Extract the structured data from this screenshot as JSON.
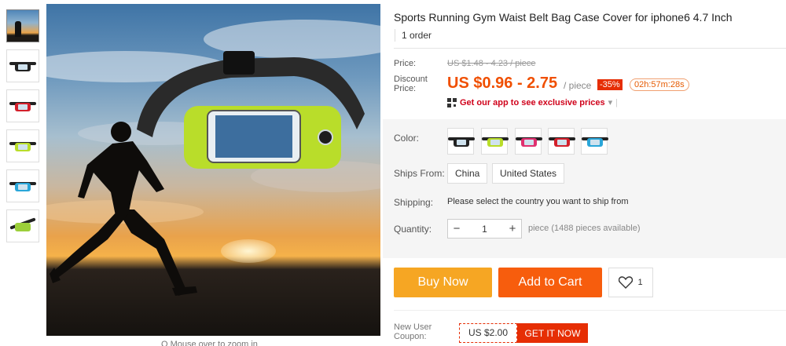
{
  "product": {
    "title": "Sports Running Gym Waist Belt Bag Case Cover for iphone6 4.7 Inch",
    "orders": "1 order"
  },
  "price": {
    "label": "Price:",
    "original": "US $1.48 - 4.23 / piece",
    "discount_label": "Discount Price:",
    "current": "US $0.96 - 2.75",
    "unit": "/ piece",
    "percent_off": "-35%",
    "countdown": "02h:57m:28s",
    "app_promo": "Get our app to see exclusive prices"
  },
  "colors": {
    "label": "Color:",
    "swatches": [
      {
        "name": "black",
        "pouch": "#222222"
      },
      {
        "name": "green",
        "pouch": "#b9dd2a"
      },
      {
        "name": "pink",
        "pouch": "#e0306f"
      },
      {
        "name": "red",
        "pouch": "#d3202b"
      },
      {
        "name": "blue",
        "pouch": "#2aa6d9"
      }
    ]
  },
  "shipping": {
    "from_label": "Ships From:",
    "from_options": [
      "China",
      "United States"
    ],
    "label": "Shipping:",
    "text": "Please select the country you want to ship from"
  },
  "quantity": {
    "label": "Quantity:",
    "value": "1",
    "minus": "−",
    "plus": "+",
    "available": "piece (1488 pieces available)"
  },
  "actions": {
    "buy_now": "Buy Now",
    "add_to_cart": "Add to Cart",
    "wishlist_count": "1"
  },
  "coupon": {
    "label": "New User Coupon:",
    "amount": "US $2.00",
    "button": "GET IT NOW"
  },
  "gallery": {
    "hint": "Q Mouse over to zoom in"
  },
  "theme": {
    "accent_price": "#f04f00",
    "buy_color": "#f6a623",
    "cart_color": "#f75d0d",
    "red": "#e62e04"
  }
}
